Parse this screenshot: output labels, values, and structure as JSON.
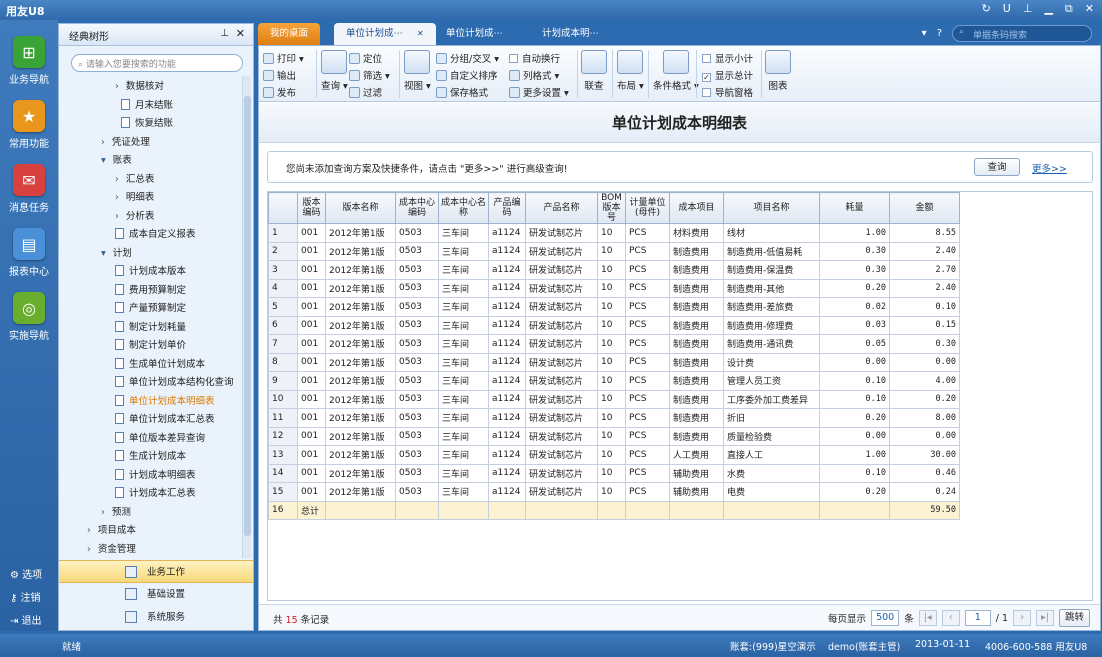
{
  "app": {
    "title": "用友U8",
    "controls": [
      "↻",
      "U",
      "⊥",
      "▁",
      "⧉",
      "✕"
    ]
  },
  "leftnav": [
    {
      "label": "业务导航",
      "icon": "business-nav-icon",
      "color": "#3aa335"
    },
    {
      "label": "常用功能",
      "icon": "star-icon",
      "color": "#e9961c"
    },
    {
      "label": "消息任务",
      "icon": "mail-icon",
      "color": "#d94040"
    },
    {
      "label": "报表中心",
      "icon": "report-icon",
      "color": "#4a90d9"
    },
    {
      "label": "实施导航",
      "icon": "compass-icon",
      "color": "#6aae2e"
    }
  ],
  "bottomnav": [
    {
      "label": "选项",
      "icon": "gear-icon"
    },
    {
      "label": "注销",
      "icon": "key-icon"
    },
    {
      "label": "退出",
      "icon": "exit-icon"
    }
  ],
  "panel": {
    "title": "经典树形",
    "search_placeholder": "请输入您要搜索的功能"
  },
  "tree": [
    {
      "label": "数据核对",
      "level": 2,
      "type": "arrow"
    },
    {
      "label": "月末结账",
      "level": 3,
      "type": "doc"
    },
    {
      "label": "恢复结账",
      "level": 3,
      "type": "doc"
    },
    {
      "label": "凭证处理",
      "level": 1,
      "type": "arrow"
    },
    {
      "label": "账表",
      "level": 1,
      "type": "open"
    },
    {
      "label": "汇总表",
      "level": 2,
      "type": "arrow"
    },
    {
      "label": "明细表",
      "level": 2,
      "type": "arrow"
    },
    {
      "label": "分析表",
      "level": 2,
      "type": "arrow"
    },
    {
      "label": "成本自定义报表",
      "level": 2,
      "type": "doc"
    },
    {
      "label": "计划",
      "level": 1,
      "type": "open"
    },
    {
      "label": "计划成本版本",
      "level": 2,
      "type": "doc"
    },
    {
      "label": "费用预算制定",
      "level": 2,
      "type": "doc"
    },
    {
      "label": "产量预算制定",
      "level": 2,
      "type": "doc"
    },
    {
      "label": "制定计划耗量",
      "level": 2,
      "type": "doc"
    },
    {
      "label": "制定计划单价",
      "level": 2,
      "type": "doc"
    },
    {
      "label": "生成单位计划成本",
      "level": 2,
      "type": "doc"
    },
    {
      "label": "单位计划成本结构化查询",
      "level": 2,
      "type": "doc"
    },
    {
      "label": "单位计划成本明细表",
      "level": 2,
      "type": "doc",
      "selected": true
    },
    {
      "label": "单位计划成本汇总表",
      "level": 2,
      "type": "doc"
    },
    {
      "label": "单位版本差异查询",
      "level": 2,
      "type": "doc"
    },
    {
      "label": "生成计划成本",
      "level": 2,
      "type": "doc"
    },
    {
      "label": "计划成本明细表",
      "level": 2,
      "type": "doc"
    },
    {
      "label": "计划成本汇总表",
      "level": 2,
      "type": "doc"
    },
    {
      "label": "预测",
      "level": 1,
      "type": "arrow"
    },
    {
      "label": "项目成本",
      "level": 0,
      "type": "arrow"
    },
    {
      "label": "资金管理",
      "level": 0,
      "type": "arrow"
    }
  ],
  "bottommenu": [
    {
      "label": "业务工作",
      "active": true
    },
    {
      "label": "基础设置"
    },
    {
      "label": "系统服务"
    }
  ],
  "tabs": [
    {
      "label": "我的桌面",
      "kind": "home"
    },
    {
      "label": "单位计划成⋯",
      "kind": "active",
      "close": "✕"
    },
    {
      "label": "单位计划成⋯"
    },
    {
      "label": "计划成本明⋯"
    }
  ],
  "tabright": {
    "dropdown": "▾",
    "help": "?",
    "search_placeholder": "单据条码搜索"
  },
  "toolbar": {
    "print": "打印",
    "output": "输出",
    "publish": "发布",
    "query": "查询",
    "locate": "定位",
    "filter": "筛选",
    "filter2": "过滤",
    "view": "视图",
    "group": "分组/交叉",
    "custom_sort": "自定义排序",
    "save_format": "保存格式",
    "auto_wrap": "自动换行",
    "column_format": "列格式",
    "more_settings": "更多设置",
    "link": "联查",
    "layout": "布局",
    "cond_format": "条件格式",
    "show_subtotal": "显示小计",
    "show_total": "显示总计",
    "nav_grid": "导航窗格",
    "chart": "图表"
  },
  "report": {
    "title": "单位计划成本明细表"
  },
  "hint": {
    "text": "您尚未添加查询方案及快捷条件，请点击 \"更多>>\" 进行高级查询!",
    "query_button": "查询",
    "more_link": "更多>>"
  },
  "grid": {
    "headers": [
      "版本编码",
      "版本名称",
      "成本中心编码",
      "成本中心名称",
      "产品编码",
      "产品名称",
      "BOM版本号",
      "计量单位(母件)",
      "成本项目",
      "项目名称",
      "耗量",
      "金额"
    ],
    "rows": [
      [
        "1",
        "001",
        "2012年第1版",
        "0503",
        "三车间",
        "a1124",
        "研发试制芯片",
        "10",
        "PCS",
        "材料费用",
        "线材",
        "1.00",
        "8.55"
      ],
      [
        "2",
        "001",
        "2012年第1版",
        "0503",
        "三车间",
        "a1124",
        "研发试制芯片",
        "10",
        "PCS",
        "制造费用",
        "制造费用-低值易耗",
        "0.30",
        "2.40"
      ],
      [
        "3",
        "001",
        "2012年第1版",
        "0503",
        "三车间",
        "a1124",
        "研发试制芯片",
        "10",
        "PCS",
        "制造费用",
        "制造费用-保温费",
        "0.30",
        "2.70"
      ],
      [
        "4",
        "001",
        "2012年第1版",
        "0503",
        "三车间",
        "a1124",
        "研发试制芯片",
        "10",
        "PCS",
        "制造费用",
        "制造费用-其他",
        "0.20",
        "2.40"
      ],
      [
        "5",
        "001",
        "2012年第1版",
        "0503",
        "三车间",
        "a1124",
        "研发试制芯片",
        "10",
        "PCS",
        "制造费用",
        "制造费用-差旅费",
        "0.02",
        "0.10"
      ],
      [
        "6",
        "001",
        "2012年第1版",
        "0503",
        "三车间",
        "a1124",
        "研发试制芯片",
        "10",
        "PCS",
        "制造费用",
        "制造费用-修理费",
        "0.03",
        "0.15"
      ],
      [
        "7",
        "001",
        "2012年第1版",
        "0503",
        "三车间",
        "a1124",
        "研发试制芯片",
        "10",
        "PCS",
        "制造费用",
        "制造费用-通讯费",
        "0.05",
        "0.30"
      ],
      [
        "8",
        "001",
        "2012年第1版",
        "0503",
        "三车间",
        "a1124",
        "研发试制芯片",
        "10",
        "PCS",
        "制造费用",
        "设计费",
        "0.00",
        "0.00"
      ],
      [
        "9",
        "001",
        "2012年第1版",
        "0503",
        "三车间",
        "a1124",
        "研发试制芯片",
        "10",
        "PCS",
        "制造费用",
        "管理人员工资",
        "0.10",
        "4.00"
      ],
      [
        "10",
        "001",
        "2012年第1版",
        "0503",
        "三车间",
        "a1124",
        "研发试制芯片",
        "10",
        "PCS",
        "制造费用",
        "工序委外加工费差异",
        "0.10",
        "0.20"
      ],
      [
        "11",
        "001",
        "2012年第1版",
        "0503",
        "三车间",
        "a1124",
        "研发试制芯片",
        "10",
        "PCS",
        "制造费用",
        "折旧",
        "0.20",
        "8.00"
      ],
      [
        "12",
        "001",
        "2012年第1版",
        "0503",
        "三车间",
        "a1124",
        "研发试制芯片",
        "10",
        "PCS",
        "制造费用",
        "质量检验费",
        "0.00",
        "0.00"
      ],
      [
        "13",
        "001",
        "2012年第1版",
        "0503",
        "三车间",
        "a1124",
        "研发试制芯片",
        "10",
        "PCS",
        "人工费用",
        "直接人工",
        "1.00",
        "30.00"
      ],
      [
        "14",
        "001",
        "2012年第1版",
        "0503",
        "三车间",
        "a1124",
        "研发试制芯片",
        "10",
        "PCS",
        "辅助费用",
        "水费",
        "0.10",
        "0.46"
      ],
      [
        "15",
        "001",
        "2012年第1版",
        "0503",
        "三车间",
        "a1124",
        "研发试制芯片",
        "10",
        "PCS",
        "辅助费用",
        "电费",
        "0.20",
        "0.24"
      ]
    ],
    "total": {
      "row_no": "16",
      "label": "总计",
      "amount": "59.50"
    }
  },
  "pager": {
    "prefix": "共",
    "count": "15",
    "suffix": "条记录",
    "page_size_label": "每页显示",
    "page_size": "500",
    "unit": "条",
    "page": "1",
    "pages": "/ 1",
    "go": "跳转"
  },
  "status": {
    "left": "就绪",
    "account": "账套:(999)星空演示",
    "user": "demo(账套主管)",
    "date": "2013-01-11",
    "hotline": "4006-600-588 用友U8"
  }
}
